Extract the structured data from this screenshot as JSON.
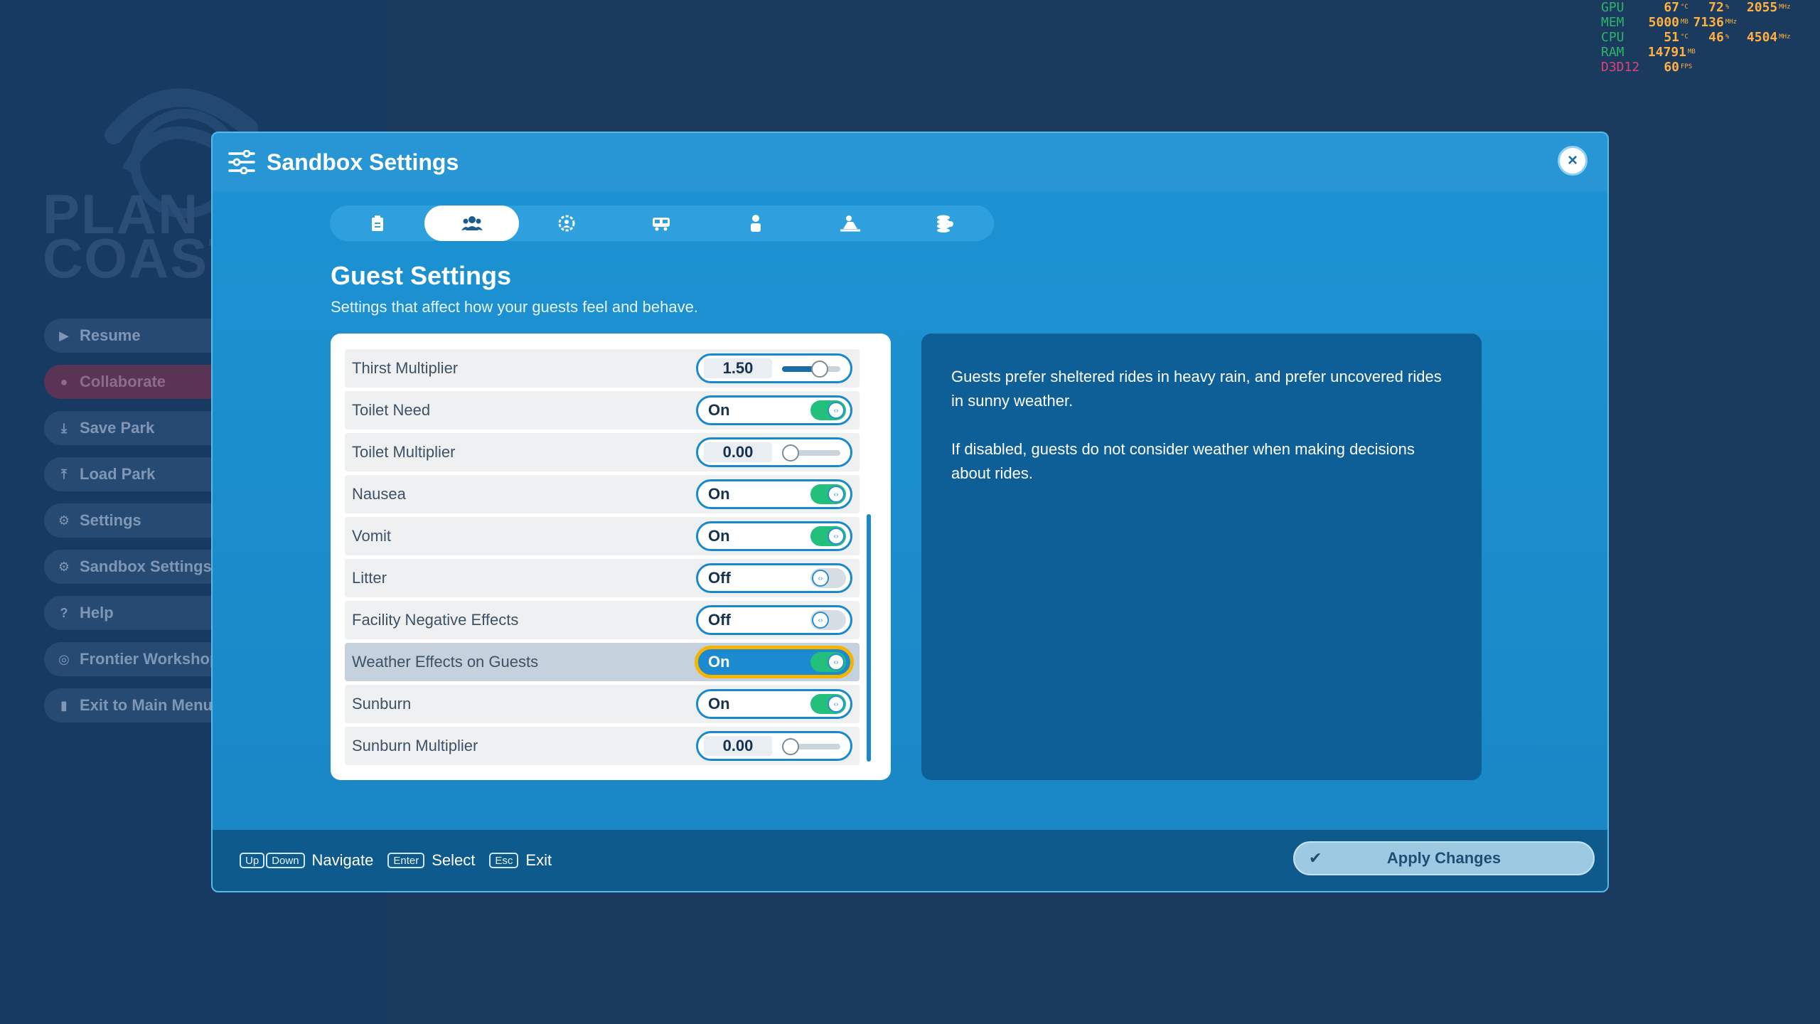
{
  "perf_overlay": {
    "rows": [
      {
        "label": "GPU",
        "v1": "67",
        "u1": "°C",
        "v2": "72",
        "u2": "%",
        "v3": "2055",
        "u3": "MHz"
      },
      {
        "label": "MEM",
        "v1": "5000",
        "u1": "MB",
        "v2": "7136",
        "u2": "MHz",
        "v3": "",
        "u3": ""
      },
      {
        "label": "CPU",
        "v1": "51",
        "u1": "°C",
        "v2": "46",
        "u2": "%",
        "v3": "4504",
        "u3": "MHz"
      },
      {
        "label": "RAM",
        "v1": "14791",
        "u1": "MB",
        "v2": "",
        "u2": "",
        "v3": "",
        "u3": ""
      },
      {
        "label": "D3D12",
        "v1": "60",
        "u1": "FPS",
        "v2": "",
        "u2": "",
        "v3": "",
        "u3": ""
      }
    ]
  },
  "pause_menu": {
    "logo_text_line1": "PLAN",
    "logo_text_line2": "COAST",
    "items": [
      {
        "label": "Resume",
        "icon": "play-icon"
      },
      {
        "label": "Collaborate",
        "icon": "collaborate-icon"
      },
      {
        "label": "Save Park",
        "icon": "save-icon"
      },
      {
        "label": "Load Park",
        "icon": "load-icon"
      },
      {
        "label": "Settings",
        "icon": "gear-icon"
      },
      {
        "label": "Sandbox Settings",
        "icon": "gear-icon"
      },
      {
        "label": "Help",
        "icon": "help-icon"
      },
      {
        "label": "Frontier Workshop",
        "icon": "workshop-icon"
      },
      {
        "label": "Exit to Main Menu",
        "icon": "exit-icon"
      }
    ]
  },
  "dialog": {
    "title": "Sandbox Settings",
    "close_label": "×",
    "tabs": [
      {
        "icon": "clipboard-icon",
        "active": false
      },
      {
        "icon": "guests-icon",
        "active": true
      },
      {
        "icon": "staff-gear-icon",
        "active": false
      },
      {
        "icon": "ride-vehicle-icon",
        "active": false
      },
      {
        "icon": "person-icon",
        "active": false
      },
      {
        "icon": "coaster-icon",
        "active": false
      },
      {
        "icon": "finance-coins-icon",
        "active": false
      }
    ],
    "section_title": "Guest Settings",
    "section_subtitle": "Settings that affect how your guests feel and behave.",
    "settings": [
      {
        "label": "Thirst Multiplier",
        "type": "slider",
        "value": "1.50",
        "fraction": 0.75
      },
      {
        "label": "Toilet Need",
        "type": "toggle",
        "value": "On"
      },
      {
        "label": "Toilet Multiplier",
        "type": "slider",
        "value": "0.00",
        "fraction": 0.0
      },
      {
        "label": "Nausea",
        "type": "toggle",
        "value": "On"
      },
      {
        "label": "Vomit",
        "type": "toggle",
        "value": "On"
      },
      {
        "label": "Litter",
        "type": "toggle",
        "value": "Off"
      },
      {
        "label": "Facility Negative Effects",
        "type": "toggle",
        "value": "Off"
      },
      {
        "label": "Weather Effects on Guests",
        "type": "toggle",
        "value": "On",
        "selected": true
      },
      {
        "label": "Sunburn",
        "type": "toggle",
        "value": "On"
      },
      {
        "label": "Sunburn Multiplier",
        "type": "slider",
        "value": "0.00",
        "fraction": 0.0
      }
    ],
    "description": {
      "p1": "Guests prefer sheltered rides in heavy rain, and prefer uncovered rides in sunny weather.",
      "p2": "If disabled, guests do not consider weather when making decisions about rides."
    },
    "footer": {
      "hints": [
        {
          "keys": [
            "Up",
            "Down"
          ],
          "label": "Navigate"
        },
        {
          "keys": [
            "Enter"
          ],
          "label": "Select"
        },
        {
          "keys": [
            "Esc"
          ],
          "label": "Exit"
        }
      ],
      "apply_label": "Apply Changes"
    }
  },
  "colors": {
    "dialog_bg": "#1a8ccb",
    "toggle_on": "#22c07a",
    "focus_outline": "#f4b400",
    "footer_bg": "#0f5a8d"
  }
}
